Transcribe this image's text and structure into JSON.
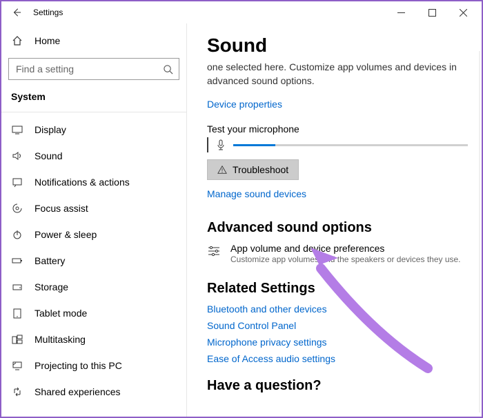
{
  "titlebar": {
    "title": "Settings"
  },
  "sidebar": {
    "home_label": "Home",
    "search_placeholder": "Find a setting",
    "group_label": "System",
    "items": [
      {
        "label": "Display"
      },
      {
        "label": "Sound"
      },
      {
        "label": "Notifications & actions"
      },
      {
        "label": "Focus assist"
      },
      {
        "label": "Power & sleep"
      },
      {
        "label": "Battery"
      },
      {
        "label": "Storage"
      },
      {
        "label": "Tablet mode"
      },
      {
        "label": "Multitasking"
      },
      {
        "label": "Projecting to this PC"
      },
      {
        "label": "Shared experiences"
      }
    ]
  },
  "main": {
    "title": "Sound",
    "description": "one selected here. Customize app volumes and devices in advanced sound options.",
    "device_properties_link": "Device properties",
    "test_label": "Test your microphone",
    "troubleshoot_label": "Troubleshoot",
    "manage_devices_link": "Manage sound devices",
    "advanced_heading": "Advanced sound options",
    "advanced_item_title": "App volume and device preferences",
    "advanced_item_sub": "Customize app volumes and the speakers or devices they use.",
    "related_heading": "Related Settings",
    "related_links": {
      "bluetooth": "Bluetooth and other devices",
      "control_panel": "Sound Control Panel",
      "mic_privacy": "Microphone privacy settings",
      "ease_audio": "Ease of Access audio settings"
    },
    "question_heading": "Have a question?"
  }
}
